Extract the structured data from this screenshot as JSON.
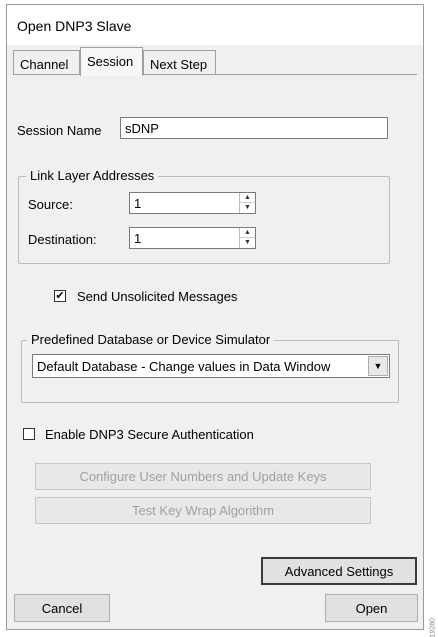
{
  "window": {
    "title": "Open DNP3 Slave"
  },
  "tabs": [
    {
      "label": "Channel",
      "active": false
    },
    {
      "label": "Session",
      "active": true
    },
    {
      "label": "Next Step",
      "active": false
    }
  ],
  "session": {
    "name_label": "Session Name",
    "name_value": "sDNP"
  },
  "link_layer": {
    "legend": "Link Layer Addresses",
    "source_label": "Source:",
    "source_value": "1",
    "destination_label": "Destination:",
    "destination_value": "1"
  },
  "unsolicited": {
    "label": "Send Unsolicited Messages",
    "checked": true
  },
  "database": {
    "legend": "Predefined Database or Device Simulator",
    "selected": "Default Database - Change values in Data Window"
  },
  "secure_auth": {
    "label": "Enable DNP3 Secure Authentication",
    "checked": false
  },
  "buttons": {
    "configure_keys": "Configure User Numbers and Update Keys",
    "test_key_wrap": "Test Key Wrap Algorithm",
    "advanced_settings": "Advanced Settings",
    "cancel": "Cancel",
    "open": "Open"
  },
  "watermark": "19280"
}
